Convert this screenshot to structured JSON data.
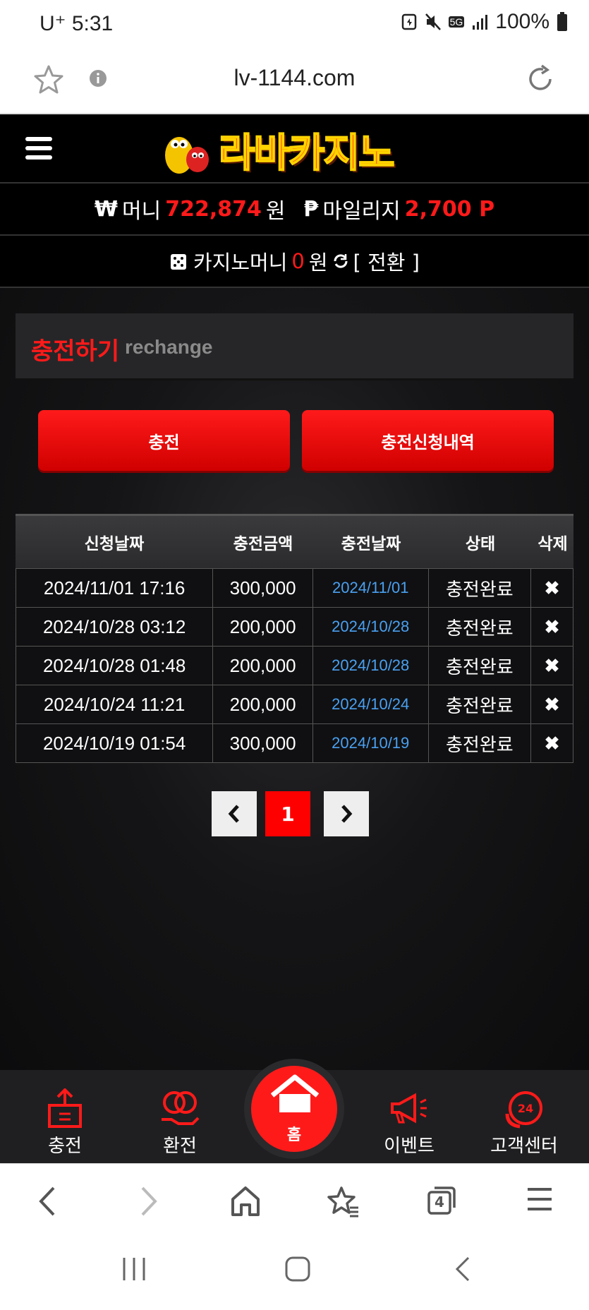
{
  "status": {
    "carrier_time": "U⁺ 5:31",
    "battery": "100%",
    "network": "5G"
  },
  "browser": {
    "url": "lv-1144.com",
    "tabs_count": "4"
  },
  "site": {
    "logo_text": "라바카지노",
    "money_label": "머니",
    "money_value": "722,874",
    "won": "원",
    "mileage_label": "마일리지",
    "mileage_value": "2,700 P",
    "casino_label": "카지노머니",
    "casino_value": "0",
    "casino_won": "원",
    "convert_label": "[ 전환 ]"
  },
  "section": {
    "title": "충전하기",
    "subtitle": "rechange"
  },
  "buttons": {
    "charge": "충전",
    "history": "충전신청내역"
  },
  "table": {
    "headers": [
      "신청날짜",
      "충전금액",
      "충전날짜",
      "상태",
      "삭제"
    ],
    "rows": [
      {
        "req": "2024/11/01 17:16",
        "amount": "300,000",
        "date": "2024/11/01",
        "status": "충전완료",
        "del": "✖"
      },
      {
        "req": "2024/10/28 03:12",
        "amount": "200,000",
        "date": "2024/10/28",
        "status": "충전완료",
        "del": "✖"
      },
      {
        "req": "2024/10/28 01:48",
        "amount": "200,000",
        "date": "2024/10/28",
        "status": "충전완료",
        "del": "✖"
      },
      {
        "req": "2024/10/24 11:21",
        "amount": "200,000",
        "date": "2024/10/24",
        "status": "충전완료",
        "del": "✖"
      },
      {
        "req": "2024/10/19 01:54",
        "amount": "300,000",
        "date": "2024/10/19",
        "status": "충전완료",
        "del": "✖"
      }
    ]
  },
  "pager": {
    "prev": "‹",
    "current": "1",
    "next": "›"
  },
  "bottom_nav": {
    "charge": "충전",
    "exchange": "환전",
    "home": "홈",
    "event": "이벤트",
    "support": "고객센터",
    "support_badge": "24"
  },
  "colors": {
    "accent": "#ff1a1a",
    "link_blue": "#4aa0f0",
    "bg": "#0d0d0f"
  }
}
